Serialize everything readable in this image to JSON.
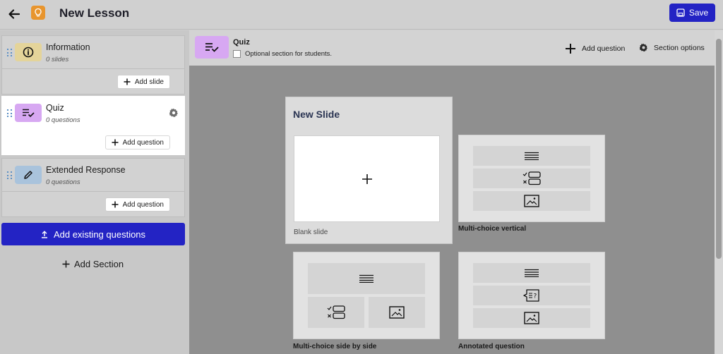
{
  "header": {
    "title": "New Lesson",
    "save_label": "Save"
  },
  "sidebar": {
    "sections": [
      {
        "title": "Information",
        "subtitle": "0 slides",
        "add_label": "Add slide",
        "icon": "info-icon",
        "icon_bg": "#e4d49a"
      },
      {
        "title": "Quiz",
        "subtitle": "0 questions",
        "add_label": "Add question",
        "icon": "checklist-icon",
        "icon_bg": "#d7a8f2"
      },
      {
        "title": "Extended Response",
        "subtitle": "0 questions",
        "add_label": "Add question",
        "icon": "pencil-icon",
        "icon_bg": "#a9c3dc"
      }
    ],
    "add_existing_label": "Add existing questions",
    "add_section_label": "Add Section"
  },
  "main": {
    "section_title": "Quiz",
    "optional_label": "Optional section for students.",
    "add_question_label": "Add question",
    "section_options_label": "Section options"
  },
  "new_slide": {
    "title": "New Slide",
    "blank_label": "Blank slide",
    "templates": [
      {
        "label": "Multi-choice vertical"
      },
      {
        "label": "Multi-choice side by side"
      },
      {
        "label": "Annotated question"
      }
    ]
  },
  "colors": {
    "primary": "#2323c4",
    "lesson_icon": "#e8952e"
  }
}
